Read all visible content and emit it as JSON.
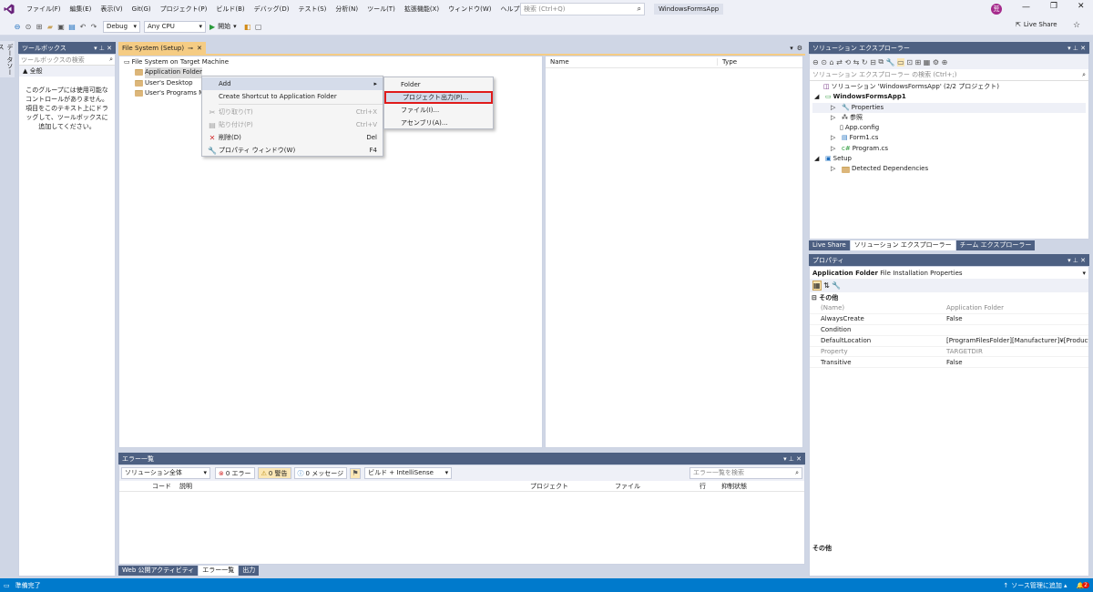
{
  "menubar": {
    "items": [
      "ファイル(F)",
      "編集(E)",
      "表示(V)",
      "Git(G)",
      "プロジェクト(P)",
      "ビルド(B)",
      "デバッグ(D)",
      "テスト(S)",
      "分析(N)",
      "ツール(T)",
      "拡張機能(X)",
      "ウィンドウ(W)",
      "ヘルプ(H)"
    ],
    "search_placeholder": "検索 (Ctrl+Q)",
    "app_title": "WindowsFormsApp",
    "avatar": "荒",
    "live_share": "Live Share"
  },
  "toolbar": {
    "config": "Debug",
    "platform": "Any CPU",
    "start": "開始"
  },
  "side_tab": {
    "label": "データソース"
  },
  "toolbox": {
    "title": "ツールボックス",
    "search_placeholder": "ツールボックスの検索",
    "group": "▲ 全般",
    "empty_text": "このグループには使用可能なコントロールがありません。項目をこのテキスト上にドラッグして、ツールボックスに追加してください。"
  },
  "editor": {
    "tab": "File System (Setup)",
    "tree": [
      "File System on Target Machine",
      "Application Folder",
      "User's Desktop",
      "User's Programs M"
    ],
    "col_name": "Name",
    "col_type": "Type"
  },
  "context_menu": {
    "items": [
      {
        "label": "Add",
        "key": ""
      },
      {
        "label": "Create Shortcut to Application Folder",
        "key": ""
      },
      {
        "label": "切り取り(T)",
        "key": "Ctrl+X"
      },
      {
        "label": "貼り付け(P)",
        "key": "Ctrl+V"
      },
      {
        "label": "削除(D)",
        "key": "Del"
      },
      {
        "label": "プロパティ ウィンドウ(W)",
        "key": "F4"
      }
    ]
  },
  "submenu": {
    "items": [
      "Folder",
      "プロジェクト出力(P)...",
      "ファイル(I)...",
      "アセンブリ(A)..."
    ]
  },
  "error_list": {
    "title": "エラー一覧",
    "scope": "ソリューション全体",
    "errors": "0 エラー",
    "warnings": "0 警告",
    "messages": "0 メッセージ",
    "build": "ビルド + IntelliSense",
    "search_placeholder": "エラー一覧を検索",
    "cols": [
      "コード",
      "説明",
      "プロジェクト",
      "ファイル",
      "行",
      "抑制状態"
    ],
    "tabs": [
      "Web 公開アクティビティ",
      "エラー一覧",
      "出力"
    ]
  },
  "solution_explorer": {
    "title": "ソリューション エクスプローラー",
    "search_placeholder": "ソリューション エクスプローラー の検索 (Ctrl+;)",
    "items": [
      "ソリューション 'WindowsFormsApp' (2/2 プロジェクト)",
      "WindowsFormsApp1",
      "Properties",
      "参照",
      "App.config",
      "Form1.cs",
      "Program.cs",
      "Setup",
      "Detected Dependencies"
    ],
    "tabs": [
      "Live Share",
      "ソリューション エクスプローラー",
      "チーム エクスプローラー"
    ]
  },
  "properties": {
    "title": "プロパティ",
    "object_name": "Application Folder",
    "object_type": "File Installation Properties",
    "category": "⊟ その他",
    "rows": [
      {
        "name": "(Name)",
        "value": "Application Folder"
      },
      {
        "name": "AlwaysCreate",
        "value": "False"
      },
      {
        "name": "Condition",
        "value": ""
      },
      {
        "name": "DefaultLocation",
        "value": "[ProgramFilesFolder][Manufacturer]¥[ProductN"
      },
      {
        "name": "Property",
        "value": "TARGETDIR"
      },
      {
        "name": "Transitive",
        "value": "False"
      }
    ],
    "desc_title": "その他"
  },
  "status": {
    "ready": "準備完了",
    "source_control": "ソース管理に追加",
    "badge": "2"
  }
}
